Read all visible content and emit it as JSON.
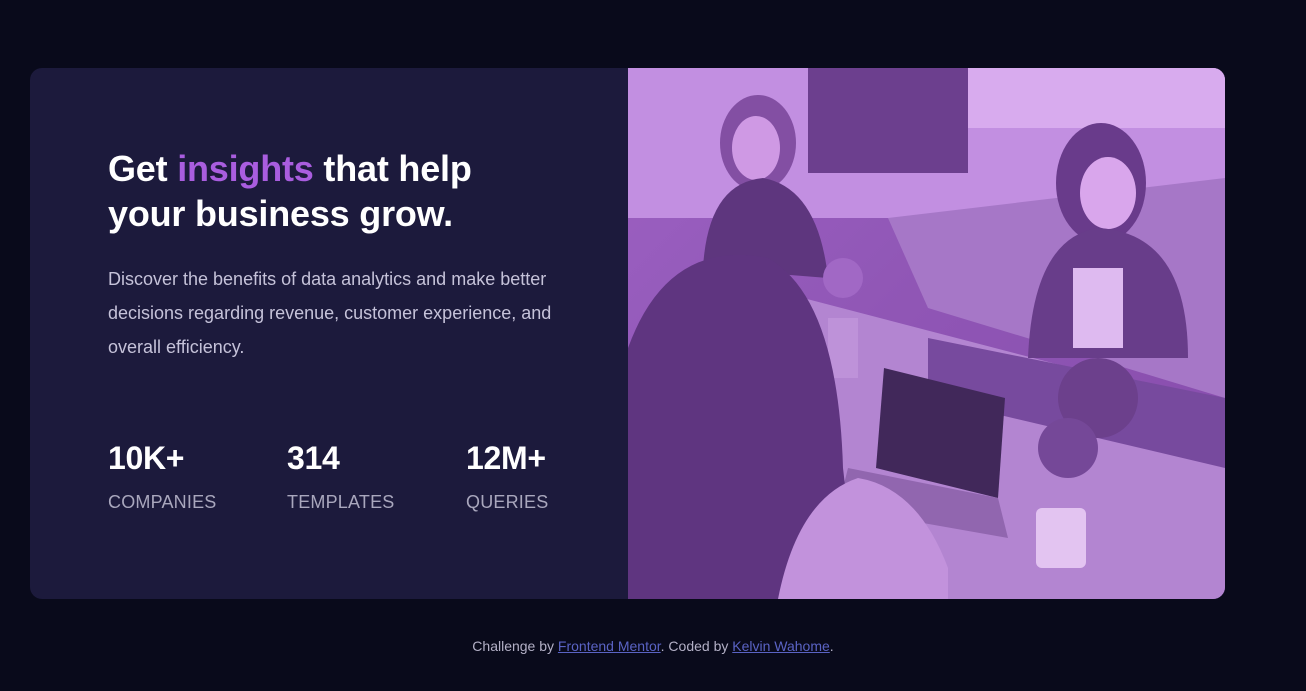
{
  "hero": {
    "title_before": "Get ",
    "title_accent": "insights",
    "title_after": " that help your business grow.",
    "description": "Discover the benefits of data analytics and make better decisions regarding revenue, customer experience, and overall efficiency."
  },
  "stats": [
    {
      "value": "10K+",
      "label": "companies"
    },
    {
      "value": "314",
      "label": "templates"
    },
    {
      "value": "12M+",
      "label": "queries"
    }
  ],
  "image": {
    "icon": "team-working-photo"
  },
  "footer": {
    "prefix": "Challenge by ",
    "link1": "Frontend Mentor",
    "middle": ". Coded by ",
    "link2": "Kelvin Wahome",
    "suffix": "."
  },
  "colors": {
    "background": "#090a1b",
    "card": "#1c1a3c",
    "accent": "#a95ddf",
    "link": "#5a63c4"
  }
}
